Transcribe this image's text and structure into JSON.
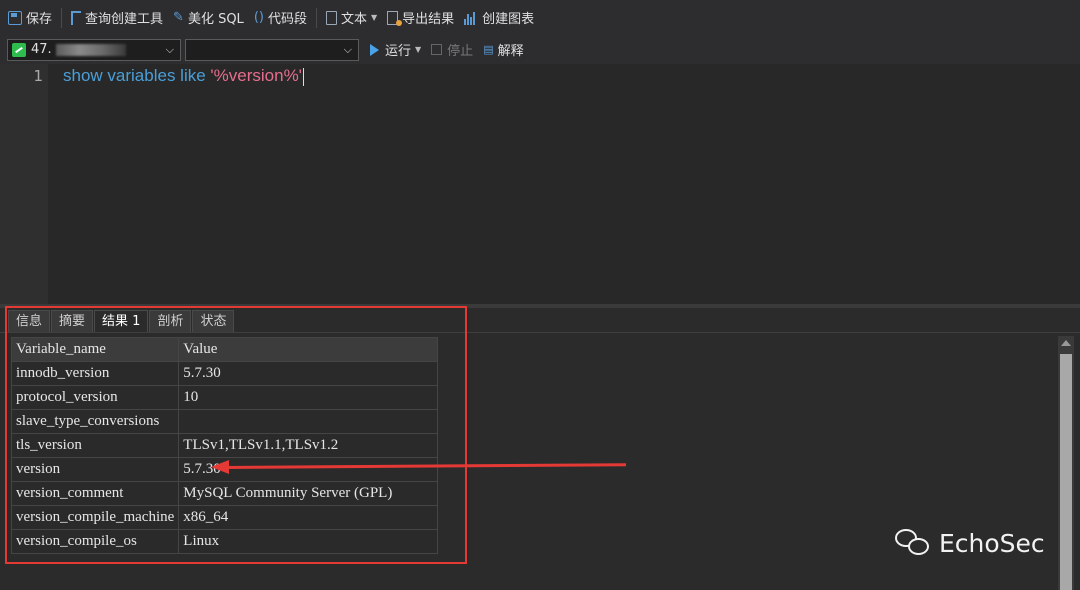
{
  "toolbar": {
    "save": "保存",
    "query_builder": "查询创建工具",
    "beautify": "美化 SQL",
    "snippet": "代码段",
    "text": "文本",
    "export": "导出结果",
    "create_chart": "创建图表"
  },
  "run_bar": {
    "connection": "47.",
    "database": "",
    "run": "运行",
    "stop": "停止",
    "explain": "解释"
  },
  "editor": {
    "line_number": "1",
    "code_keywords": "show variables like ",
    "code_string": "'%version%'"
  },
  "results": {
    "tabs": [
      "信息",
      "摘要",
      "结果 1",
      "剖析",
      "状态"
    ],
    "active_tab": "结果 1",
    "columns": [
      "Variable_name",
      "Value"
    ],
    "rows": [
      [
        "innodb_version",
        "5.7.30"
      ],
      [
        "protocol_version",
        "10"
      ],
      [
        "slave_type_conversions",
        ""
      ],
      [
        "tls_version",
        "TLSv1,TLSv1.1,TLSv1.2"
      ],
      [
        "version",
        "5.7.30"
      ],
      [
        "version_comment",
        "MySQL Community Server (GPL)"
      ],
      [
        "version_compile_machine",
        "x86_64"
      ],
      [
        "version_compile_os",
        "Linux"
      ]
    ]
  },
  "watermark": "EchoSec",
  "colors": {
    "annotation": "#e53935",
    "keyword": "#4a9fd8",
    "string": "#e56e8e",
    "connection_icon": "#2ebc4f"
  }
}
